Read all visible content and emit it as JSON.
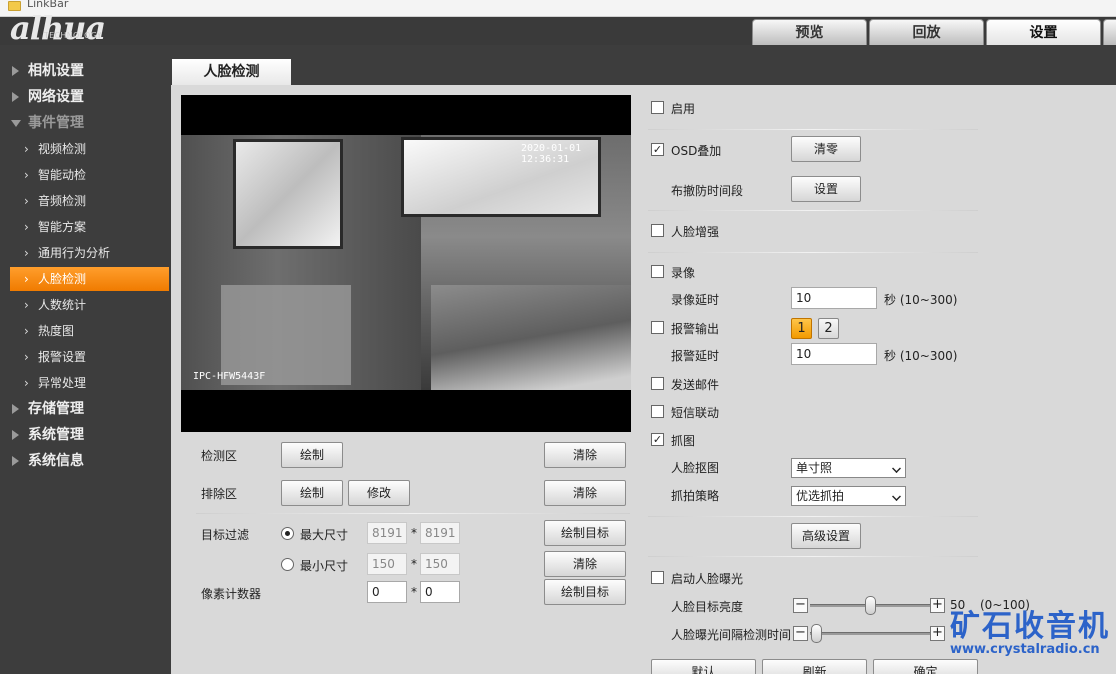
{
  "linkbar": {
    "label": "LinkBar"
  },
  "header": {
    "logo": "alhua",
    "logo_sub": "TECHNOLOGY",
    "tabs": [
      "预览",
      "回放",
      "设置"
    ]
  },
  "sidebar": {
    "groups": [
      "相机设置",
      "网络设置",
      "事件管理",
      "存储管理",
      "系统管理",
      "系统信息"
    ],
    "event_items": [
      "视频检测",
      "智能动检",
      "音频检测",
      "智能方案",
      "通用行为分析",
      "人脸检测",
      "人数统计",
      "热度图",
      "报警设置",
      "异常处理"
    ]
  },
  "page": {
    "tab": "人脸检测"
  },
  "video": {
    "osd_time": "2020-01-01 12:36:31",
    "osd_name": "IPC-HFW5443F"
  },
  "left_form": {
    "detect_zone": "检测区",
    "draw": "绘制",
    "clear": "清除",
    "exclude_zone": "排除区",
    "modify": "修改",
    "target_filter": "目标过滤",
    "max_size": "最大尺寸",
    "max_w": "8191",
    "max_h": "8191",
    "draw_target": "绘制目标",
    "min_size": "最小尺寸",
    "min_w": "150",
    "min_h": "150",
    "pixel_counter": "像素计数器",
    "px_w": "0",
    "px_h": "0",
    "times": "*"
  },
  "right_form": {
    "enable": "启用",
    "osd_overlay": "OSD叠加",
    "reset": "清零",
    "arm_period": "布撤防时间段",
    "setup": "设置",
    "face_enhance": "人脸增强",
    "record": "录像",
    "record_delay_label": "录像延时",
    "record_delay": "10",
    "delay_unit": "秒 (10~300)",
    "alarm_out": "报警输出",
    "alarm_btn1": "1",
    "alarm_btn2": "2",
    "alarm_delay_label": "报警延时",
    "alarm_delay": "10",
    "send_email": "发送邮件",
    "sms_link": "短信联动",
    "snapshot": "抓图",
    "face_crop_label": "人脸抠图",
    "face_crop": "单寸照",
    "capture_strategy_label": "抓拍策略",
    "capture_strategy": "优选抓拍",
    "advanced": "高级设置",
    "face_exposure": "启动人脸曝光",
    "face_brightness_label": "人脸目标亮度",
    "face_brightness": "50",
    "brightness_range": "(0~100)",
    "exposure_interval_label": "人脸曝光间隔检测时间",
    "brightness_level": 0.5,
    "interval_level": 0.05
  },
  "footer": {
    "default": "默认",
    "refresh": "刷新",
    "ok": "确定"
  },
  "watermark": {
    "big": "矿石收音机",
    "small": "www.crystalradio.cn"
  },
  "colors": {
    "accent": "#f28a10",
    "sidebar": "#3d3d3d",
    "header": "#3a3a3a"
  }
}
